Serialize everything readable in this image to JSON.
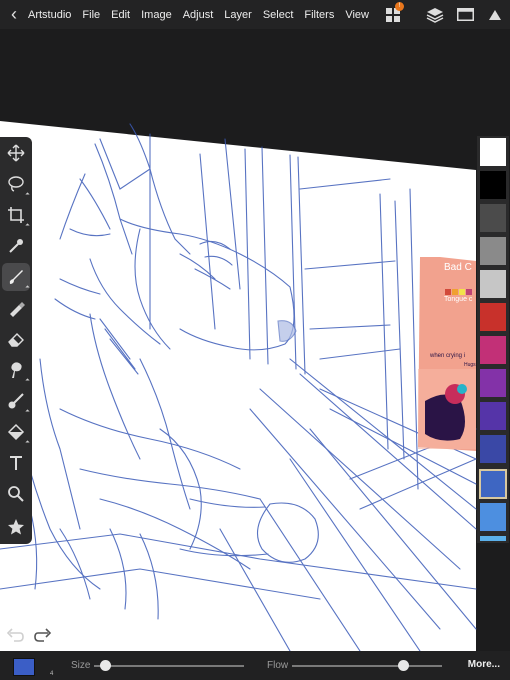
{
  "app": {
    "name": "Artstudio"
  },
  "menu": [
    "File",
    "Edit",
    "Image",
    "Adjust",
    "Layer",
    "Select",
    "Filters",
    "View"
  ],
  "top_right_icons": [
    {
      "icon": "grid-apps-icon",
      "badge": "!"
    },
    {
      "icon": "layers-icon"
    },
    {
      "icon": "window-icon"
    },
    {
      "icon": "collapse-triangle-icon"
    }
  ],
  "tools": [
    {
      "icon": "move-icon"
    },
    {
      "icon": "lasso-icon"
    },
    {
      "icon": "crop-icon"
    },
    {
      "icon": "eyedropper-icon"
    },
    {
      "icon": "brush-icon",
      "active": true
    },
    {
      "icon": "eraser-pen-icon"
    },
    {
      "icon": "eraser-icon"
    },
    {
      "icon": "smudge-icon"
    },
    {
      "icon": "blend-icon"
    },
    {
      "icon": "fill-bucket-icon"
    },
    {
      "icon": "text-icon"
    },
    {
      "icon": "zoom-icon"
    },
    {
      "icon": "star-icon"
    }
  ],
  "palette": [
    "#ffffff",
    "#000000",
    "#4b4b4b",
    "#8a8a8a",
    "#c6c6c6",
    "#c8312b",
    "#c23077",
    "#8332a8",
    "#5534a8",
    "#3a48a6",
    "#3e66c2",
    "#4d8fe0"
  ],
  "selected_swatch_index": 10,
  "brush": {
    "current_color": "#3b5ec6",
    "color_number": "4"
  },
  "sliders": {
    "size_label": "Size",
    "flow_label": "Flow",
    "size_value": 0.07,
    "flow_value": 0.74
  },
  "more_label": "More...",
  "reference_card": {
    "lines": [
      "Bad C",
      "Tongue c",
      "when crying i",
      "Hugs"
    ]
  }
}
